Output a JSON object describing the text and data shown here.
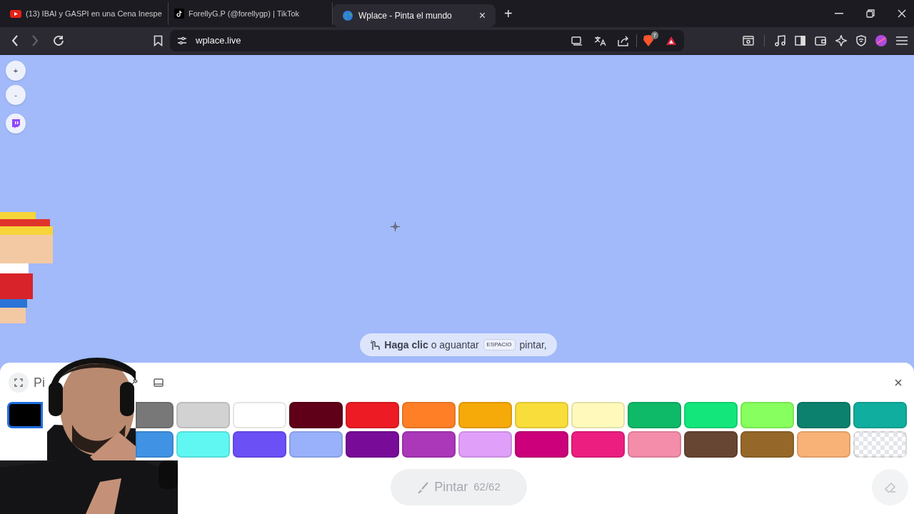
{
  "browser": {
    "tabs": [
      {
        "title": "(13) IBAI y GASPI en una Cena Inespe",
        "kind": "video",
        "selected": false
      },
      {
        "title": "ForellyG.P (@forellygp) | TikTok",
        "kind": "music",
        "selected": false
      },
      {
        "title": "Wplace - Pinta el mundo",
        "kind": "globe",
        "selected": true
      }
    ],
    "new_tab": "+",
    "close_tab": "×",
    "address": "wplace.live",
    "shield_count": "7"
  },
  "map": {
    "zoom_in": "+",
    "zoom_out": "-",
    "hint": "**Haga clic** o aguantar",
    "hint_key": "ESPACIO",
    "hint_end": "pintar,"
  },
  "panel": {
    "title": "Pi",
    "palette": [
      {
        "color": "#000000",
        "selected": true,
        "kind": "left-part"
      },
      {
        "kind": "covered"
      },
      {
        "color": "#787878",
        "selected": false,
        "kind": "right-part"
      },
      {
        "color": "#d2d2d2",
        "selected": false
      },
      {
        "color": "#ffffff",
        "selected": false
      },
      {
        "color": "#600018",
        "selected": false
      },
      {
        "color": "#ed1c24",
        "selected": false
      },
      {
        "color": "#ff7f27",
        "selected": false
      },
      {
        "color": "#f6aa09",
        "selected": false
      },
      {
        "color": "#f9dd3b",
        "selected": false
      },
      {
        "color": "#fffabc",
        "selected": false
      },
      {
        "color": "#0eb968",
        "selected": false
      },
      {
        "color": "#13e67b",
        "selected": false
      },
      {
        "color": "#87ff5e",
        "selected": false
      },
      {
        "color": "#0c816e",
        "selected": false
      },
      {
        "color": "#10ae9f",
        "selected": false
      },
      {
        "kind": "covered"
      },
      {
        "kind": "covered"
      },
      {
        "color": "#4093e4",
        "selected": false,
        "kind": "right-part"
      },
      {
        "color": "#60f7f2",
        "selected": false
      },
      {
        "color": "#6b50f6",
        "selected": false
      },
      {
        "color": "#99b1fb",
        "selected": false
      },
      {
        "color": "#780c99",
        "selected": false
      },
      {
        "color": "#aa38b9",
        "selected": false
      },
      {
        "color": "#e09ff9",
        "selected": false
      },
      {
        "color": "#cb007a",
        "selected": false
      },
      {
        "color": "#ec1f80",
        "selected": false
      },
      {
        "color": "#f38da9",
        "selected": false
      },
      {
        "color": "#684634",
        "selected": false
      },
      {
        "color": "#95682a",
        "selected": false
      },
      {
        "color": "#f8b277",
        "selected": false
      },
      {
        "kind": "transparent",
        "selected": false
      }
    ],
    "paint_label": "Pintar",
    "paint_count": "62/62",
    "paint_disabled": true
  }
}
